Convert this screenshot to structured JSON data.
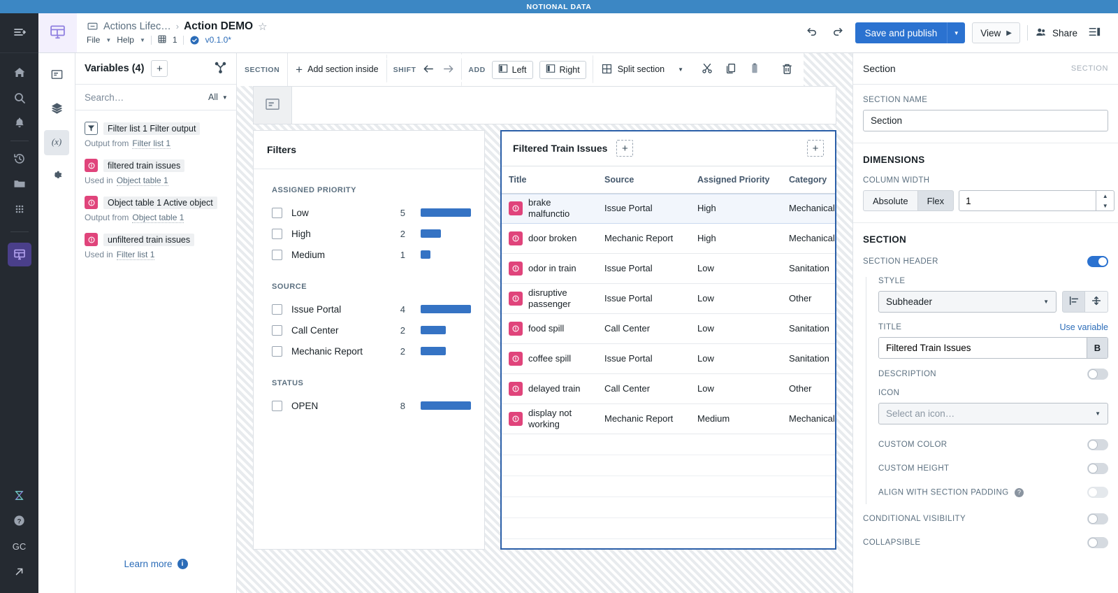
{
  "banner": {
    "text": "NOTIONAL DATA"
  },
  "header": {
    "breadcrumb_parent": "Actions Lifec…",
    "breadcrumb_sep": "›",
    "title": "Action DEMO",
    "star_icon": "star-outline-icon",
    "doc_icon": "document-icon",
    "menus": [
      "File",
      "Help"
    ],
    "branch_count": "1",
    "version": "v0.1.0*",
    "undo_icon": "undo-icon",
    "redo_icon": "redo-icon",
    "save_label": "Save and publish",
    "save_split_icon": "chevron-down-icon",
    "view_label": "View",
    "view_icon": "play-icon",
    "share_label": "Share",
    "share_icon": "people-icon",
    "panel_toggle_icon": "right-panel-icon"
  },
  "rail": {
    "collapse_icon": "expand-menu-icon",
    "items": [
      {
        "icon": "home-icon"
      },
      {
        "icon": "search-icon"
      },
      {
        "icon": "bell-icon"
      },
      {
        "icon": "history-icon"
      },
      {
        "icon": "folder-icon"
      },
      {
        "icon": "apps-grid-icon"
      }
    ],
    "active_icon": "workshop-app-icon",
    "bottom": [
      {
        "icon": "hourglass-logo-icon"
      },
      {
        "icon": "help-icon"
      },
      {
        "label": "GC",
        "icon": "user-initials"
      },
      {
        "icon": "external-link-icon"
      }
    ]
  },
  "toolrail": {
    "items": [
      {
        "icon": "widget-icon",
        "selected": false
      },
      {
        "icon": "layers-icon",
        "selected": false
      },
      {
        "icon": "variables-fx-icon",
        "selected": true
      },
      {
        "icon": "gear-icon",
        "selected": false
      }
    ]
  },
  "variables_panel": {
    "title": "Variables (4)",
    "add_icon": "plus-icon",
    "graph_icon": "variable-graph-icon",
    "search_placeholder": "Search…",
    "search_value": "",
    "filter_label": "All",
    "filter_caret": "chevron-down-icon",
    "items": [
      {
        "badge": "filter-icon",
        "badge_type": "filter",
        "name": "Filter list 1 Filter output",
        "relation": "Output from",
        "target": "Filter list 1"
      },
      {
        "badge": "object-icon",
        "badge_type": "object",
        "name": "filtered train issues",
        "relation": "Used in",
        "target": "Object table 1"
      },
      {
        "badge": "object-icon",
        "badge_type": "object",
        "name": "Object table 1 Active object",
        "relation": "Output from",
        "target": "Object table 1"
      },
      {
        "badge": "object-icon",
        "badge_type": "object",
        "name": "unfiltered train issues",
        "relation": "Used in",
        "target": "Filter list 1"
      }
    ],
    "learn_more": "Learn more",
    "info_icon": "info-icon"
  },
  "section_toolbar": {
    "label": "SECTION",
    "add_section_inside": "Add section inside",
    "add_icon": "plus-icon",
    "shift_label": "SHIFT",
    "shift_left_icon": "arrow-left-icon",
    "shift_right_icon": "arrow-right-icon",
    "add_label": "ADD",
    "add_left": "Left",
    "add_left_icon": "panel-left-icon",
    "add_right": "Right",
    "add_right_icon": "panel-right-icon",
    "split_section": "Split section",
    "split_icon": "split-icon",
    "split_caret": "chevron-down-icon",
    "cut_icon": "scissors-icon",
    "copy_icon": "copy-icon",
    "paste_icon": "clipboard-icon",
    "delete_icon": "trash-icon"
  },
  "canvas": {
    "strip_icon": "header-widget-icon",
    "filters_panel": {
      "title": "Filters",
      "groups": [
        {
          "title": "ASSIGNED PRIORITY",
          "rows": [
            {
              "label": "Low",
              "count": "5",
              "checked": false
            },
            {
              "label": "High",
              "count": "2",
              "checked": false
            },
            {
              "label": "Medium",
              "count": "1",
              "checked": false
            }
          ]
        },
        {
          "title": "SOURCE",
          "rows": [
            {
              "label": "Issue Portal",
              "count": "4",
              "checked": false
            },
            {
              "label": "Call Center",
              "count": "2",
              "checked": false
            },
            {
              "label": "Mechanic Report",
              "count": "2",
              "checked": false
            }
          ]
        },
        {
          "title": "STATUS",
          "rows": [
            {
              "label": "OPEN",
              "count": "8",
              "checked": false
            }
          ]
        }
      ]
    },
    "table_panel": {
      "title": "Filtered Train Issues",
      "add_icon_left": "plus-icon",
      "add_icon_right": "plus-icon",
      "columns": [
        "Title",
        "Source",
        "Assigned Priority",
        "Category"
      ],
      "rows": [
        {
          "badge": "object-icon",
          "title": "brake malfunctio",
          "source": "Issue Portal",
          "priority": "High",
          "category": "Mechanical",
          "selected": true
        },
        {
          "badge": "object-icon",
          "title": "door broken",
          "source": "Mechanic Report",
          "priority": "High",
          "category": "Mechanical",
          "selected": false
        },
        {
          "badge": "object-icon",
          "title": "odor in train",
          "source": "Issue Portal",
          "priority": "Low",
          "category": "Sanitation",
          "selected": false
        },
        {
          "badge": "object-icon",
          "title": "disruptive passenger",
          "source": "Issue Portal",
          "priority": "Low",
          "category": "Other",
          "selected": false
        },
        {
          "badge": "object-icon",
          "title": "food spill",
          "source": "Call Center",
          "priority": "Low",
          "category": "Sanitation",
          "selected": false
        },
        {
          "badge": "object-icon",
          "title": "coffee spill",
          "source": "Issue Portal",
          "priority": "Low",
          "category": "Sanitation",
          "selected": false
        },
        {
          "badge": "object-icon",
          "title": "delayed train",
          "source": "Call Center",
          "priority": "Low",
          "category": "Other",
          "selected": false
        },
        {
          "badge": "object-icon",
          "title": "display not working",
          "source": "Mechanic Report",
          "priority": "Medium",
          "category": "Mechanical",
          "selected": false
        }
      ],
      "empty_row_count": 7
    }
  },
  "inspector": {
    "title": "Section",
    "type_tag": "SECTION",
    "section_name_label": "SECTION NAME",
    "section_name_value": "Section",
    "dimensions_label": "DIMENSIONS",
    "column_width_label": "COLUMN WIDTH",
    "width_mode_absolute": "Absolute",
    "width_mode_flex": "Flex",
    "width_mode_selected": "Flex",
    "width_value": "1",
    "spinner_up_icon": "chevron-up-icon",
    "spinner_down_icon": "chevron-down-icon",
    "section_label": "SECTION",
    "section_header_label": "SECTION HEADER",
    "section_header_on": true,
    "style_label": "STYLE",
    "style_value": "Subheader",
    "style_caret": "chevron-down-icon",
    "align_left_icon": "align-left-icon",
    "align_vertical_icon": "align-vertical-icon",
    "title_label": "TITLE",
    "use_variable": "Use variable",
    "title_value": "Filtered Train Issues",
    "bold_button": "B",
    "description_label": "DESCRIPTION",
    "description_on": false,
    "icon_label": "ICON",
    "icon_placeholder": "Select an icon…",
    "icon_caret": "chevron-down-icon",
    "custom_color_label": "CUSTOM COLOR",
    "custom_color_on": false,
    "custom_height_label": "CUSTOM HEIGHT",
    "custom_height_on": false,
    "align_padding_label": "ALIGN WITH SECTION PADDING",
    "align_padding_help_icon": "help-circle-icon",
    "align_padding_on": false,
    "conditional_visibility_label": "CONDITIONAL VISIBILITY",
    "conditional_visibility_on": false,
    "collapsible_label": "COLLAPSIBLE",
    "collapsible_on": false
  },
  "colors": {
    "accent_blue": "#2b72d0",
    "banner_blue": "#3c87c4",
    "pink_badge": "#e0447b",
    "bar_blue": "#3573c4",
    "selection_border": "#2b5fa8"
  }
}
